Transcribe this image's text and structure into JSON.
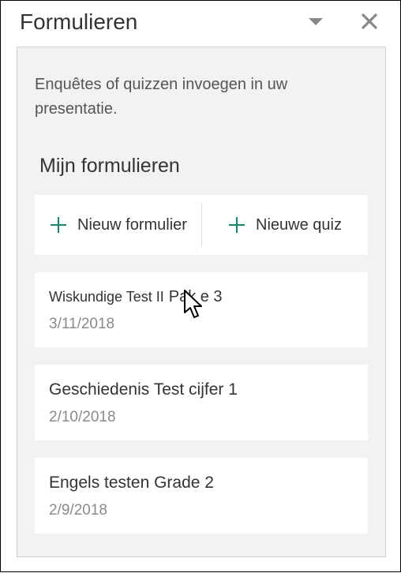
{
  "titlebar": {
    "title": "Formulieren"
  },
  "intro": "Enquêtes of quizzen invoegen in uw presentatie.",
  "section_title": "Mijn formulieren",
  "new_buttons": {
    "form_label": "Nieuw formulier",
    "quiz_label": "Nieuwe quiz"
  },
  "cards": [
    {
      "title_main": "Wiskundige Test II",
      "title_aux": "Pak e 3",
      "date": "3/11/2018"
    },
    {
      "title": "Geschiedenis Test cijfer 1",
      "date": "2/10/2018"
    },
    {
      "title": "Engels testen Grade 2",
      "date": "2/9/2018"
    }
  ],
  "colors": {
    "accent": "#0b8a6f"
  }
}
